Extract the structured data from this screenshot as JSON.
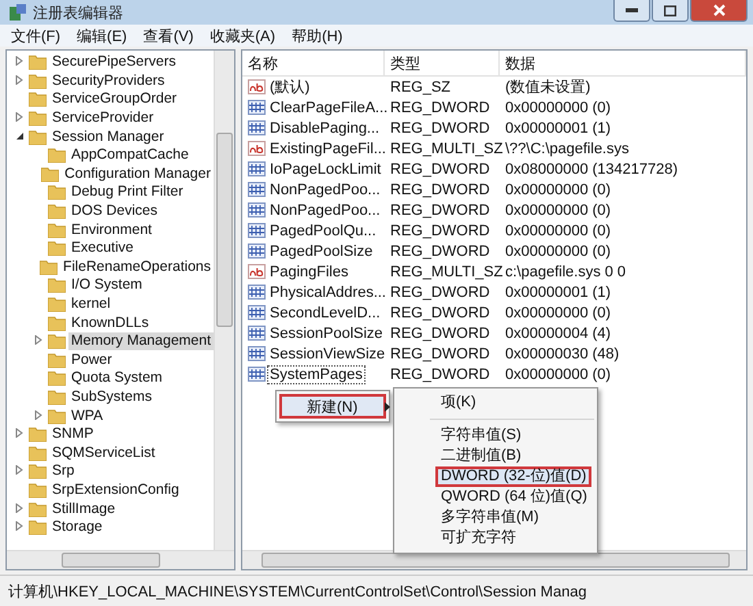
{
  "window": {
    "title": "注册表编辑器"
  },
  "menu": [
    "文件(F)",
    "编辑(E)",
    "查看(V)",
    "收藏夹(A)",
    "帮助(H)"
  ],
  "tree": [
    {
      "kind": "branch",
      "label": "SecurePipeServers",
      "expanded": false,
      "selected": false
    },
    {
      "kind": "branch",
      "label": "SecurityProviders",
      "expanded": false,
      "selected": false
    },
    {
      "kind": "leaf",
      "label": "ServiceGroupOrder",
      "selected": false
    },
    {
      "kind": "branch",
      "label": "ServiceProvider",
      "expanded": false,
      "selected": false
    },
    {
      "kind": "branch",
      "label": "Session Manager",
      "expanded": true,
      "selected": false,
      "children": [
        {
          "kind": "leaf",
          "label": "AppCompatCache",
          "selected": false
        },
        {
          "kind": "leaf",
          "label": "Configuration Manager",
          "selected": false
        },
        {
          "kind": "leaf",
          "label": "Debug Print Filter",
          "selected": false
        },
        {
          "kind": "leaf",
          "label": "DOS Devices",
          "selected": false
        },
        {
          "kind": "leaf",
          "label": "Environment",
          "selected": false
        },
        {
          "kind": "leaf",
          "label": "Executive",
          "selected": false
        },
        {
          "kind": "leaf",
          "label": "FileRenameOperations",
          "selected": false
        },
        {
          "kind": "leaf",
          "label": "I/O System",
          "selected": false
        },
        {
          "kind": "leaf",
          "label": "kernel",
          "selected": false
        },
        {
          "kind": "leaf",
          "label": "KnownDLLs",
          "selected": false
        },
        {
          "kind": "branch",
          "label": "Memory Management",
          "expanded": false,
          "selected": true
        },
        {
          "kind": "leaf",
          "label": "Power",
          "selected": false
        },
        {
          "kind": "leaf",
          "label": "Quota System",
          "selected": false
        },
        {
          "kind": "leaf",
          "label": "SubSystems",
          "selected": false
        },
        {
          "kind": "branch",
          "label": "WPA",
          "expanded": false,
          "selected": false
        }
      ]
    },
    {
      "kind": "branch",
      "label": "SNMP",
      "expanded": false,
      "selected": false
    },
    {
      "kind": "leaf",
      "label": "SQMServiceList",
      "selected": false
    },
    {
      "kind": "branch",
      "label": "Srp",
      "expanded": false,
      "selected": false
    },
    {
      "kind": "leaf",
      "label": "SrpExtensionConfig",
      "selected": false
    },
    {
      "kind": "branch",
      "label": "StillImage",
      "expanded": false,
      "selected": false
    },
    {
      "kind": "branch",
      "label": "Storage",
      "expanded": false,
      "selected": false
    }
  ],
  "table": {
    "columns": [
      "名称",
      "类型",
      "数据"
    ],
    "rows": [
      {
        "kind": "string",
        "name": "(默认)",
        "type": "REG_SZ",
        "data": "(数值未设置)",
        "focused": false
      },
      {
        "kind": "dword",
        "name": "ClearPageFileA...",
        "type": "REG_DWORD",
        "data": "0x00000000 (0)",
        "focused": false
      },
      {
        "kind": "dword",
        "name": "DisablePaging...",
        "type": "REG_DWORD",
        "data": "0x00000001 (1)",
        "focused": false
      },
      {
        "kind": "string",
        "name": "ExistingPageFil...",
        "type": "REG_MULTI_SZ",
        "data": "\\??\\C:\\pagefile.sys",
        "focused": false
      },
      {
        "kind": "dword",
        "name": "IoPageLockLimit",
        "type": "REG_DWORD",
        "data": "0x08000000 (134217728)",
        "focused": false
      },
      {
        "kind": "dword",
        "name": "NonPagedPoo...",
        "type": "REG_DWORD",
        "data": "0x00000000 (0)",
        "focused": false
      },
      {
        "kind": "dword",
        "name": "NonPagedPoo...",
        "type": "REG_DWORD",
        "data": "0x00000000 (0)",
        "focused": false
      },
      {
        "kind": "dword",
        "name": "PagedPoolQu...",
        "type": "REG_DWORD",
        "data": "0x00000000 (0)",
        "focused": false
      },
      {
        "kind": "dword",
        "name": "PagedPoolSize",
        "type": "REG_DWORD",
        "data": "0x00000000 (0)",
        "focused": false
      },
      {
        "kind": "string",
        "name": "PagingFiles",
        "type": "REG_MULTI_SZ",
        "data": "c:\\pagefile.sys 0 0",
        "focused": false
      },
      {
        "kind": "dword",
        "name": "PhysicalAddres...",
        "type": "REG_DWORD",
        "data": "0x00000001 (1)",
        "focused": false
      },
      {
        "kind": "dword",
        "name": "SecondLevelD...",
        "type": "REG_DWORD",
        "data": "0x00000000 (0)",
        "focused": false
      },
      {
        "kind": "dword",
        "name": "SessionPoolSize",
        "type": "REG_DWORD",
        "data": "0x00000004 (4)",
        "focused": false
      },
      {
        "kind": "dword",
        "name": "SessionViewSize",
        "type": "REG_DWORD",
        "data": "0x00000030 (48)",
        "focused": false
      },
      {
        "kind": "dword",
        "name": "SystemPages",
        "type": "REG_DWORD",
        "data": "0x00000000 (0)",
        "focused": true
      }
    ]
  },
  "context_menu": {
    "label": "新建(N)",
    "highlighted": true
  },
  "submenu": [
    {
      "label": "项(K)",
      "highlighted": false,
      "separator_after": true
    },
    {
      "label": "字符串值(S)",
      "highlighted": false,
      "separator_after": false
    },
    {
      "label": "二进制值(B)",
      "highlighted": false,
      "separator_after": false
    },
    {
      "label": "DWORD (32-位)值(D)",
      "highlighted": true,
      "separator_after": false
    },
    {
      "label": "QWORD (64 位)值(Q)",
      "highlighted": false,
      "separator_after": false
    },
    {
      "label": "多字符串值(M)",
      "highlighted": false,
      "separator_after": false
    },
    {
      "label": "可扩充字符",
      "highlighted": false,
      "separator_after": false
    }
  ],
  "status_bar": "计算机\\HKEY_LOCAL_MACHINE\\SYSTEM\\CurrentControlSet\\Control\\Session Manag"
}
